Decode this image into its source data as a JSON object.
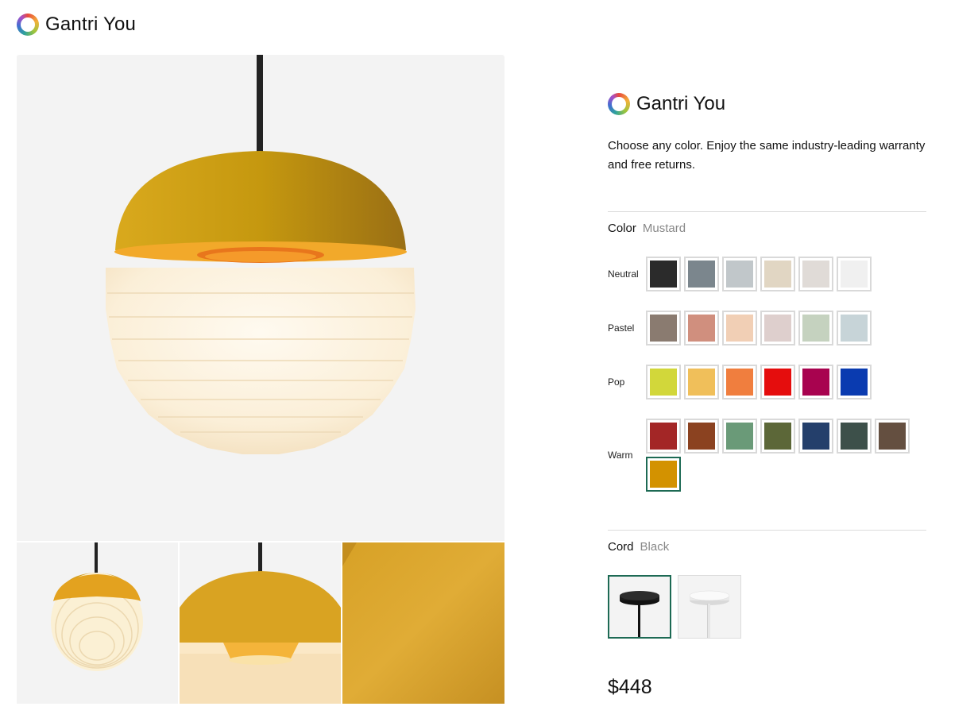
{
  "header": {
    "brand": "Gantri You",
    "logo_icon": "color-ring-logo-icon"
  },
  "gallery": {
    "main_alt": "Mustard pendant lamp",
    "thumbnails": [
      "pendant-full-view",
      "shade-closeup",
      "mustard-texture"
    ]
  },
  "product": {
    "brand": "Gantri You",
    "description": "Choose any color. Enjoy the same industry-leading warranty and free returns.",
    "color_label": "Color",
    "color_value": "Mustard",
    "groups": [
      {
        "name": "Neutral",
        "swatches": [
          "#2b2b2b",
          "#7b868d",
          "#c1c7ca",
          "#e1d6c3",
          "#e0dbd7",
          "#f0f0f0"
        ]
      },
      {
        "name": "Pastel",
        "swatches": [
          "#8a7b70",
          "#d08f7e",
          "#f1cfb5",
          "#decfcd",
          "#c5d2bf",
          "#c7d4d8"
        ]
      },
      {
        "name": "Pop",
        "swatches": [
          "#d2d73a",
          "#f0bf5a",
          "#f07e3e",
          "#e50d0d",
          "#a8034f",
          "#0a3bb0"
        ]
      },
      {
        "name": "Warm",
        "swatches": [
          "#a32626",
          "#8b4220",
          "#6a9a78",
          "#5c6738",
          "#243f6b",
          "#3d504a",
          "#644f40",
          "#d39200"
        ]
      }
    ],
    "selected_color": "#d39200",
    "cord_label": "Cord",
    "cord_value": "Black",
    "cords": [
      "Black",
      "White"
    ],
    "price": "$448"
  },
  "colors": {
    "accent": "#1d6a54",
    "mustard": "#d39200"
  }
}
